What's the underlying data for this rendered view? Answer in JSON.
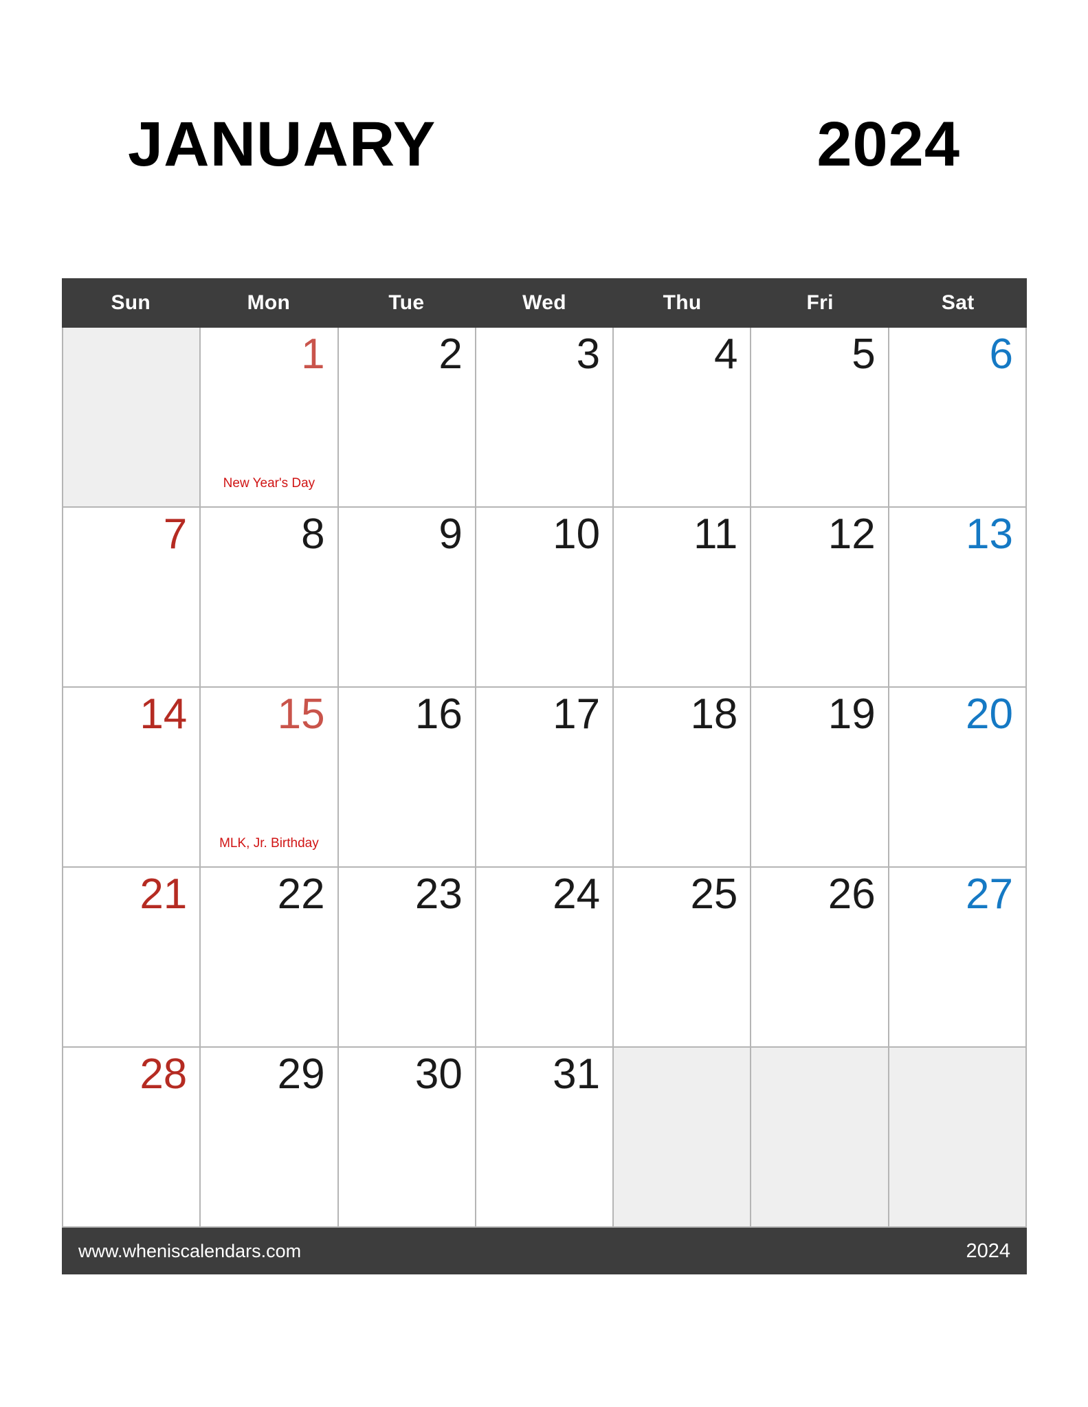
{
  "header": {
    "month": "JANUARY",
    "year": "2024"
  },
  "weekdays": [
    {
      "label": "Sun"
    },
    {
      "label": "Mon"
    },
    {
      "label": "Tue"
    },
    {
      "label": "Wed"
    },
    {
      "label": "Thu"
    },
    {
      "label": "Fri"
    },
    {
      "label": "Sat"
    }
  ],
  "weeks": [
    [
      {
        "day": "",
        "blank": true,
        "type": "sunday",
        "event": ""
      },
      {
        "day": "1",
        "blank": false,
        "type": "holiday",
        "event": "New Year's Day"
      },
      {
        "day": "2",
        "blank": false,
        "type": "weekday",
        "event": ""
      },
      {
        "day": "3",
        "blank": false,
        "type": "weekday",
        "event": ""
      },
      {
        "day": "4",
        "blank": false,
        "type": "weekday",
        "event": ""
      },
      {
        "day": "5",
        "blank": false,
        "type": "weekday",
        "event": ""
      },
      {
        "day": "6",
        "blank": false,
        "type": "saturday",
        "event": ""
      }
    ],
    [
      {
        "day": "7",
        "blank": false,
        "type": "sunday",
        "event": ""
      },
      {
        "day": "8",
        "blank": false,
        "type": "weekday",
        "event": ""
      },
      {
        "day": "9",
        "blank": false,
        "type": "weekday",
        "event": ""
      },
      {
        "day": "10",
        "blank": false,
        "type": "weekday",
        "event": ""
      },
      {
        "day": "11",
        "blank": false,
        "type": "weekday",
        "event": ""
      },
      {
        "day": "12",
        "blank": false,
        "type": "weekday",
        "event": ""
      },
      {
        "day": "13",
        "blank": false,
        "type": "saturday",
        "event": ""
      }
    ],
    [
      {
        "day": "14",
        "blank": false,
        "type": "sunday",
        "event": ""
      },
      {
        "day": "15",
        "blank": false,
        "type": "holiday",
        "event": "MLK, Jr. Birthday"
      },
      {
        "day": "16",
        "blank": false,
        "type": "weekday",
        "event": ""
      },
      {
        "day": "17",
        "blank": false,
        "type": "weekday",
        "event": ""
      },
      {
        "day": "18",
        "blank": false,
        "type": "weekday",
        "event": ""
      },
      {
        "day": "19",
        "blank": false,
        "type": "weekday",
        "event": ""
      },
      {
        "day": "20",
        "blank": false,
        "type": "saturday",
        "event": ""
      }
    ],
    [
      {
        "day": "21",
        "blank": false,
        "type": "sunday",
        "event": ""
      },
      {
        "day": "22",
        "blank": false,
        "type": "weekday",
        "event": ""
      },
      {
        "day": "23",
        "blank": false,
        "type": "weekday",
        "event": ""
      },
      {
        "day": "24",
        "blank": false,
        "type": "weekday",
        "event": ""
      },
      {
        "day": "25",
        "blank": false,
        "type": "weekday",
        "event": ""
      },
      {
        "day": "26",
        "blank": false,
        "type": "weekday",
        "event": ""
      },
      {
        "day": "27",
        "blank": false,
        "type": "saturday",
        "event": ""
      }
    ],
    [
      {
        "day": "28",
        "blank": false,
        "type": "sunday",
        "event": ""
      },
      {
        "day": "29",
        "blank": false,
        "type": "weekday",
        "event": ""
      },
      {
        "day": "30",
        "blank": false,
        "type": "weekday",
        "event": ""
      },
      {
        "day": "31",
        "blank": false,
        "type": "weekday",
        "event": ""
      },
      {
        "day": "",
        "blank": true,
        "type": "weekday",
        "event": ""
      },
      {
        "day": "",
        "blank": true,
        "type": "weekday",
        "event": ""
      },
      {
        "day": "",
        "blank": true,
        "type": "saturday",
        "event": ""
      }
    ]
  ],
  "footer": {
    "site": "www.wheniscalendars.com",
    "year": "2024"
  },
  "colors": {
    "header_bar": "#3d3d3d",
    "sunday": "#b52b22",
    "saturday": "#1579c4",
    "holiday_number": "#c9544b",
    "event_text": "#d01414",
    "grid_line": "#b5b5b5",
    "blank_cell": "#efefef"
  }
}
